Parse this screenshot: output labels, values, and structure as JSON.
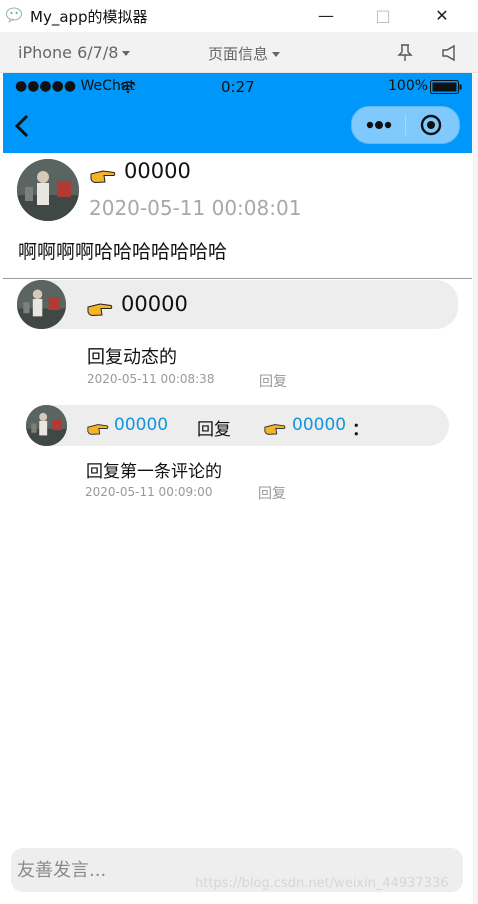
{
  "window": {
    "title": "My_app的模拟器",
    "minimize": "—",
    "maximize": "□",
    "close": "✕"
  },
  "device_bar": {
    "model": "iPhone 6/7/8",
    "page_info": "页面信息"
  },
  "status_bar": {
    "carrier": "●●●●● WeChat",
    "time": "0:27",
    "battery": "100%"
  },
  "post": {
    "author": "00000",
    "time": "2020-05-11 00:08:01",
    "content": "啊啊啊啊哈哈哈哈哈哈哈"
  },
  "comment": {
    "author": "00000",
    "content": "回复动态的",
    "time": "2020-05-11 00:08:38",
    "reply_label": "回复"
  },
  "reply": {
    "from": "00000",
    "connector": "回复",
    "to": "00000",
    "colon": "：",
    "content": "回复第一条评论的",
    "time": "2020-05-11 00:09:00",
    "reply_label": "回复"
  },
  "input": {
    "placeholder": "友善发言..."
  },
  "watermark": "https://blog.csdn.net/weixin_44937336",
  "colors": {
    "brand": "#0097fb",
    "link": "#1296db",
    "bubble": "#ededed"
  }
}
